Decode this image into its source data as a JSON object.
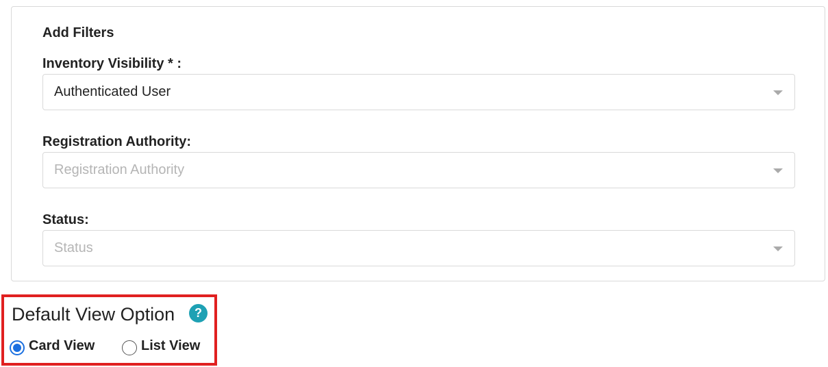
{
  "filters": {
    "heading": "Add Filters",
    "inventory_visibility": {
      "label": "Inventory Visibility * :",
      "value": "Authenticated User"
    },
    "registration_authority": {
      "label": "Registration Authority:",
      "placeholder": "Registration Authority"
    },
    "status": {
      "label": "Status:",
      "placeholder": "Status"
    }
  },
  "default_view": {
    "title": "Default View Option",
    "help_icon": "?",
    "options": [
      {
        "label": "Card View",
        "selected": true
      },
      {
        "label": "List View",
        "selected": false
      }
    ]
  },
  "colors": {
    "highlight_border": "#e02020",
    "help_icon_bg": "#1ea1b4",
    "radio_selected": "#1a6fe0"
  }
}
